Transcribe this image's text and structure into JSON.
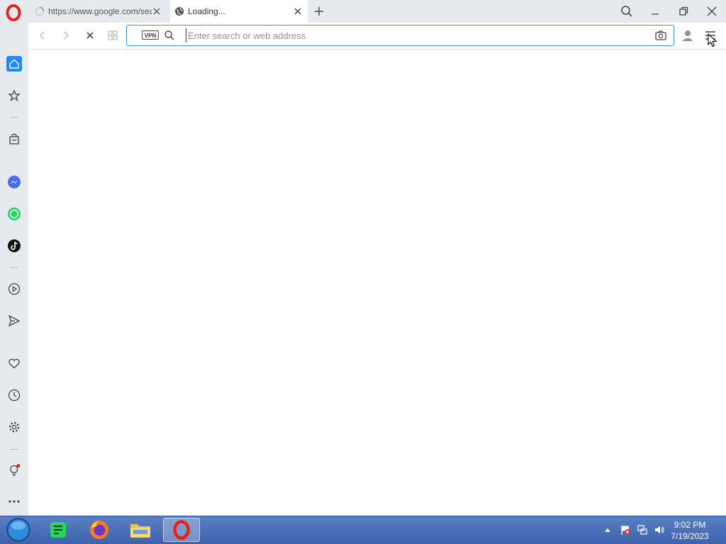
{
  "browser": {
    "tabs": [
      {
        "title": "https://www.google.com/search",
        "state": "loading"
      },
      {
        "title": "Loading...",
        "state": "active"
      }
    ]
  },
  "toolbar": {
    "vpn_label": "VPN",
    "address_placeholder": "Enter search or web address",
    "address_value": ""
  },
  "sidebar": {
    "items": [
      "home-icon",
      "star-icon",
      "shopping-bag-icon",
      "messenger-icon",
      "whatsapp-icon",
      "tiktok-icon",
      "player-icon",
      "send-icon",
      "heart-icon",
      "history-icon",
      "settings-icon",
      "lightbulb-icon",
      "more-icon"
    ]
  },
  "taskbar": {
    "apps": [
      "start-orb-icon",
      "notes-icon",
      "firefox-icon",
      "file-explorer-icon",
      "opera-icon"
    ],
    "time": "9:02 PM",
    "date": "7/19/2023"
  },
  "colors": {
    "accent": "#3b8fe0",
    "opera_red": "#e2231a",
    "chrome_gray": "#e6e9ee",
    "taskbar_blue": "#4a6fb8"
  }
}
